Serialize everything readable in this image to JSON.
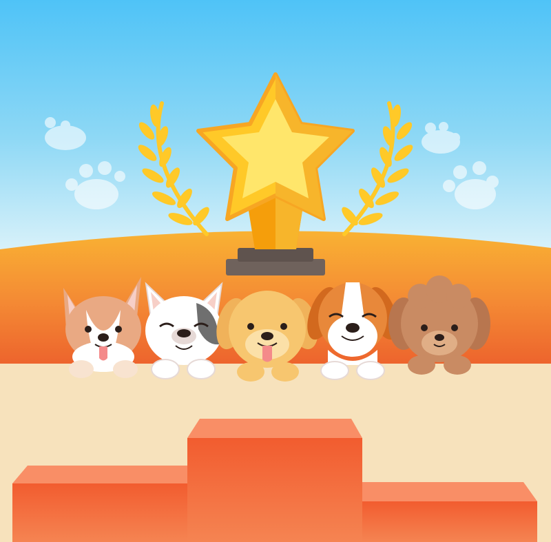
{
  "scene": {
    "subject": "dogs-at-award-podium",
    "colors": {
      "sky_top": "#4FC3F7",
      "sky_bottom": "#E3F6FB",
      "hill_top": "#F9B233",
      "hill_bottom": "#EE6A2F",
      "floor": "#F7E2BC",
      "podium_face": "#F26B3A",
      "podium_top": "#F98E66",
      "trophy_gold": "#FFC928",
      "trophy_light": "#FFE66B",
      "trophy_dark": "#F59E0B",
      "trophy_base": "#6F625C",
      "laurel": "#FFC928",
      "paw": "#FFFFFF"
    },
    "icons": [
      "star-trophy-icon",
      "laurel-left-icon",
      "laurel-right-icon",
      "paw-print-icon"
    ],
    "dogs": [
      "corgi",
      "french-bulldog",
      "golden-retriever",
      "beagle",
      "poodle"
    ],
    "podium_places": 3
  }
}
